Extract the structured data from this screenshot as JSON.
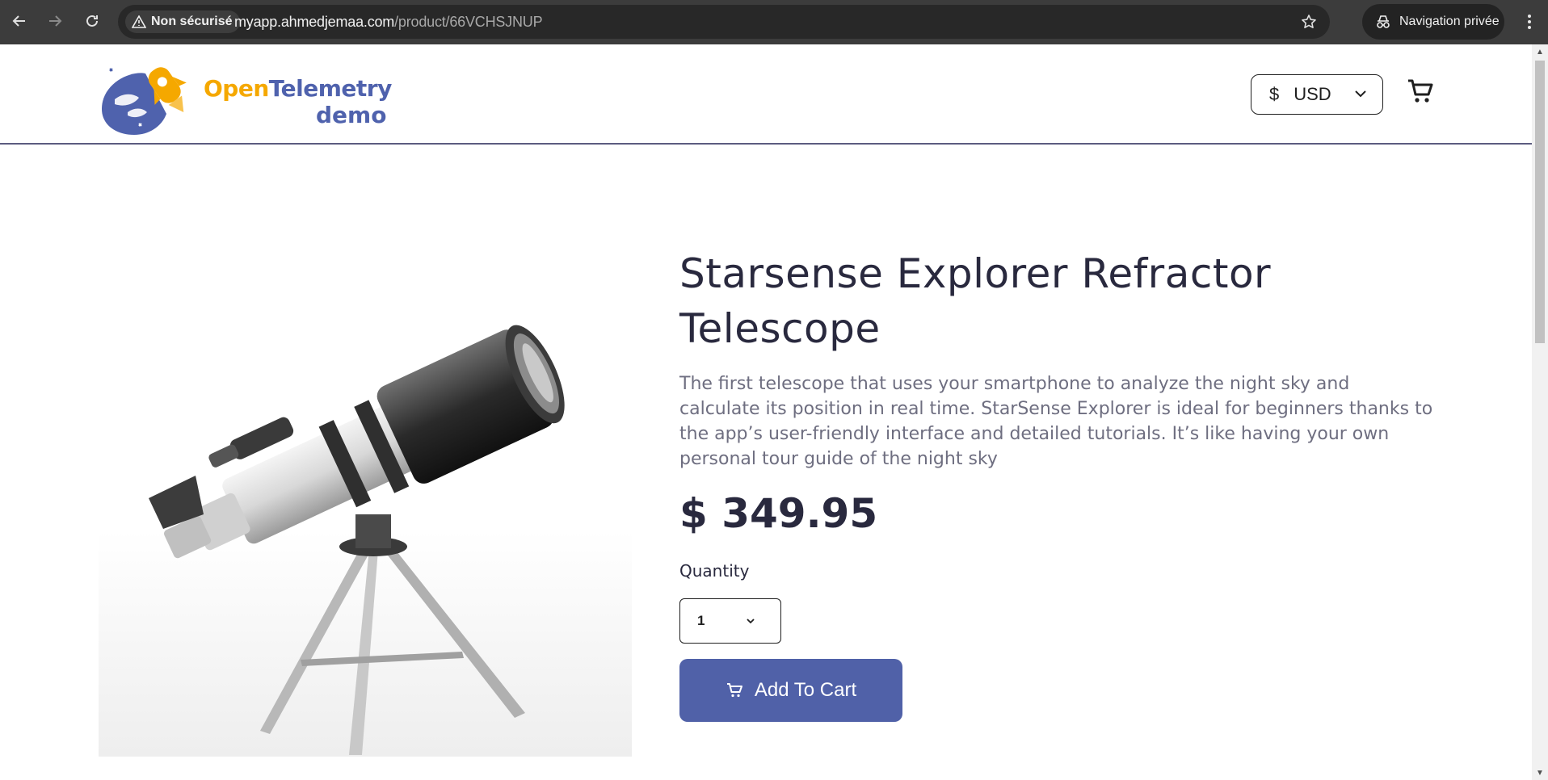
{
  "browser": {
    "back_icon": "arrow-left-icon",
    "forward_icon": "arrow-right-icon",
    "reload_icon": "reload-icon",
    "security_label": "Non sécurisé",
    "url_host": "myapp.ahmedjemaa.com",
    "url_path": "/product/66VCHSJNUP",
    "bookmark_icon": "star-icon",
    "private_label": "Navigation privée",
    "menu_icon": "kebab-menu-icon"
  },
  "header": {
    "logo_word_open": "Open",
    "logo_word_telemetry": "Telemetry",
    "logo_word_demo": "demo",
    "currency_symbol": "$",
    "currency_code": "USD",
    "cart_icon": "cart-icon"
  },
  "product": {
    "title": "Starsense Explorer Refractor Telescope",
    "description": "The first telescope that uses your smartphone to analyze the night sky and calculate its position in real time. StarSense Explorer is ideal for beginners thanks to the app’s user-friendly interface and detailed tutorials. It’s like having your own personal tour guide of the night sky",
    "price": "$ 349.95",
    "quantity_label": "Quantity",
    "quantity_value": "1",
    "add_to_cart_label": "Add To Cart"
  },
  "colors": {
    "accent": "#5061a8",
    "logo_orange": "#f5a800",
    "logo_blue": "#4f62ad",
    "text_dark": "#29293e",
    "text_muted": "#6e6e80"
  }
}
